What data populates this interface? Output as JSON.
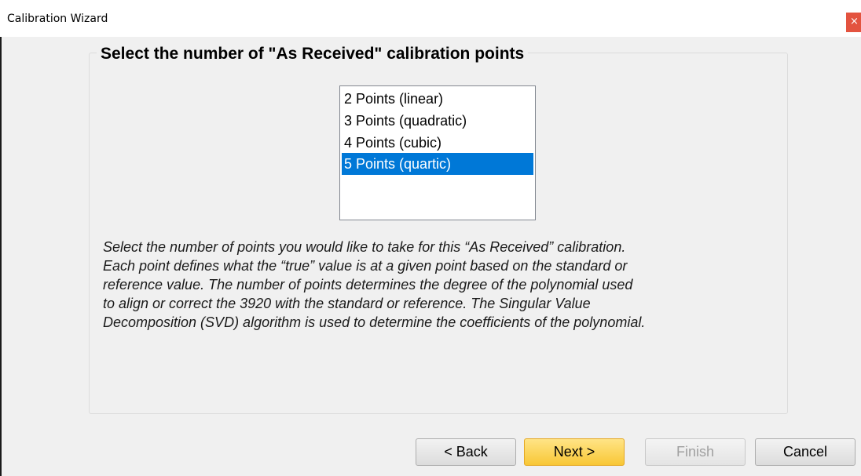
{
  "window": {
    "title": "Calibration Wizard",
    "close_glyph": "×"
  },
  "group": {
    "title": "Select the number of \"As Received\" calibration points"
  },
  "options": [
    {
      "label": "2 Points (linear)",
      "selected": false
    },
    {
      "label": "3 Points (quadratic)",
      "selected": false
    },
    {
      "label": "4 Points (cubic)",
      "selected": false
    },
    {
      "label": "5 Points (quartic)",
      "selected": true
    }
  ],
  "description": [
    "Select the number of points you would like to take for this “As Received” calibration.",
    "Each point defines what the “true” value is at a given point based on the standard or",
    "reference value.  The number of points determines the degree of the polynomial used",
    "to align or correct the 3920 with the standard or reference.  The Singular Value",
    "Decomposition (SVD) algorithm is used to determine the coefficients of the polynomial."
  ],
  "buttons": {
    "back": "< Back",
    "next": "Next >",
    "finish": "Finish",
    "cancel": "Cancel"
  },
  "colors": {
    "selection": "#0078d7",
    "close": "#e3533f",
    "primary_button": "#f8c735"
  }
}
